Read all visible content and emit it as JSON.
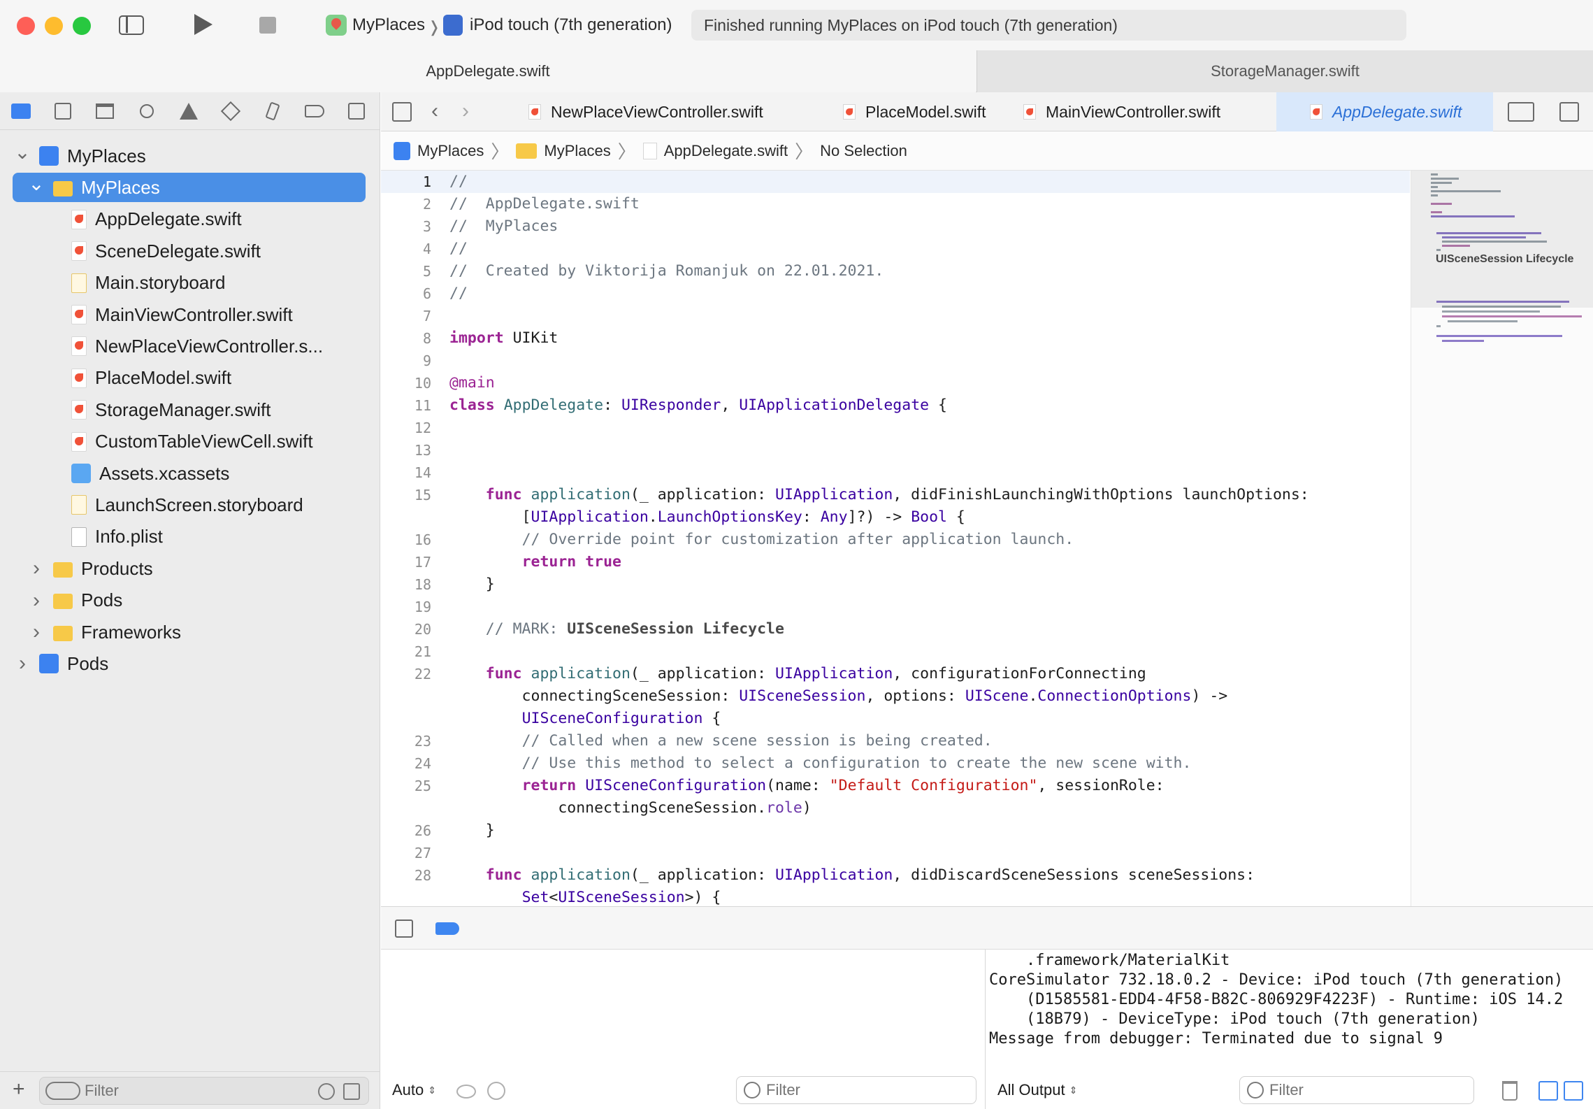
{
  "window": {
    "scheme_target": "MyPlaces",
    "scheme_device": "iPod touch (7th generation)",
    "activity_status": "Finished running MyPlaces on iPod touch (7th generation)"
  },
  "doc_tabs": {
    "left": "AppDelegate.swift",
    "right": "StorageManager.swift"
  },
  "navigator": {
    "filter_placeholder": "Filter",
    "tree": [
      {
        "label": "MyPlaces",
        "kind": "project",
        "level": 0,
        "open": true
      },
      {
        "label": "MyPlaces",
        "kind": "folder",
        "level": 1,
        "open": true,
        "selected": true
      },
      {
        "label": "AppDelegate.swift",
        "kind": "swift",
        "level": 2
      },
      {
        "label": "SceneDelegate.swift",
        "kind": "swift",
        "level": 2
      },
      {
        "label": "Main.storyboard",
        "kind": "storyboard",
        "level": 2
      },
      {
        "label": "MainViewController.swift",
        "kind": "swift",
        "level": 2
      },
      {
        "label": "NewPlaceViewController.s...",
        "kind": "swift",
        "level": 2
      },
      {
        "label": "PlaceModel.swift",
        "kind": "swift",
        "level": 2
      },
      {
        "label": "StorageManager.swift",
        "kind": "swift",
        "level": 2
      },
      {
        "label": "CustomTableViewCell.swift",
        "kind": "swift",
        "level": 2
      },
      {
        "label": "Assets.xcassets",
        "kind": "assets",
        "level": 2
      },
      {
        "label": "LaunchScreen.storyboard",
        "kind": "storyboard",
        "level": 2
      },
      {
        "label": "Info.plist",
        "kind": "plist",
        "level": 2
      },
      {
        "label": "Products",
        "kind": "folder",
        "level": 1,
        "open": false
      },
      {
        "label": "Pods",
        "kind": "folder",
        "level": 1,
        "open": false
      },
      {
        "label": "Frameworks",
        "kind": "folder",
        "level": 1,
        "open": false
      },
      {
        "label": "Pods",
        "kind": "project",
        "level": 0,
        "open": false
      }
    ]
  },
  "editor_tabs": [
    {
      "label": "NewPlaceViewController.swift",
      "active": false
    },
    {
      "label": "PlaceModel.swift",
      "active": false
    },
    {
      "label": "MainViewController.swift",
      "active": false
    },
    {
      "label": "AppDelegate.swift",
      "active": true
    }
  ],
  "jumpbar": [
    "MyPlaces",
    "MyPlaces",
    "AppDelegate.swift",
    "No Selection"
  ],
  "code": {
    "current_line": 1,
    "lines": [
      {
        "n": "1",
        "t": [
          [
            "cm",
            "//"
          ]
        ]
      },
      {
        "n": "2",
        "t": [
          [
            "cm",
            "//  AppDelegate.swift"
          ]
        ]
      },
      {
        "n": "3",
        "t": [
          [
            "cm",
            "//  MyPlaces"
          ]
        ]
      },
      {
        "n": "4",
        "t": [
          [
            "cm",
            "//"
          ]
        ]
      },
      {
        "n": "5",
        "t": [
          [
            "cm",
            "//  Created by Viktorija Romanjuk on 22.01.2021."
          ]
        ]
      },
      {
        "n": "6",
        "t": [
          [
            "cm",
            "//"
          ]
        ]
      },
      {
        "n": "7",
        "t": []
      },
      {
        "n": "8",
        "t": [
          [
            "kw",
            "import"
          ],
          [
            "",
            " UIKit"
          ]
        ]
      },
      {
        "n": "9",
        "t": []
      },
      {
        "n": "10",
        "t": [
          [
            "at",
            "@main"
          ]
        ]
      },
      {
        "n": "11",
        "t": [
          [
            "kw",
            "class"
          ],
          [
            "",
            " "
          ],
          [
            "fn",
            "AppDelegate"
          ],
          [
            "",
            ": "
          ],
          [
            "ty",
            "UIResponder"
          ],
          [
            "",
            ", "
          ],
          [
            "ty",
            "UIApplicationDelegate"
          ],
          [
            "",
            " {"
          ]
        ]
      },
      {
        "n": "12",
        "t": []
      },
      {
        "n": "13",
        "t": []
      },
      {
        "n": "14",
        "t": []
      },
      {
        "n": "15",
        "t": [
          [
            "",
            "    "
          ],
          [
            "kw",
            "func"
          ],
          [
            "",
            " "
          ],
          [
            "fn",
            "application"
          ],
          [
            "",
            "(_ application: "
          ],
          [
            "ty",
            "UIApplication"
          ],
          [
            "",
            ", didFinishLaunchingWithOptions launchOptions:"
          ]
        ]
      },
      {
        "n": "",
        "t": [
          [
            "",
            "        ["
          ],
          [
            "ty",
            "UIApplication"
          ],
          [
            "",
            "."
          ],
          [
            "ty",
            "LaunchOptionsKey"
          ],
          [
            "",
            ": "
          ],
          [
            "ty",
            "Any"
          ],
          [
            "",
            "]?) -> "
          ],
          [
            "ty",
            "Bool"
          ],
          [
            "",
            " {"
          ]
        ]
      },
      {
        "n": "16",
        "t": [
          [
            "",
            "        "
          ],
          [
            "cm",
            "// Override point for customization after application launch."
          ]
        ]
      },
      {
        "n": "17",
        "t": [
          [
            "",
            "        "
          ],
          [
            "kw",
            "return"
          ],
          [
            "",
            " "
          ],
          [
            "kw",
            "true"
          ]
        ]
      },
      {
        "n": "18",
        "t": [
          [
            "",
            "    }"
          ]
        ]
      },
      {
        "n": "19",
        "t": []
      },
      {
        "n": "20",
        "t": [
          [
            "",
            "    "
          ],
          [
            "cm",
            "// MARK: "
          ],
          [
            "mk",
            "UISceneSession Lifecycle"
          ]
        ]
      },
      {
        "n": "21",
        "t": []
      },
      {
        "n": "22",
        "t": [
          [
            "",
            "    "
          ],
          [
            "kw",
            "func"
          ],
          [
            "",
            " "
          ],
          [
            "fn",
            "application"
          ],
          [
            "",
            "(_ application: "
          ],
          [
            "ty",
            "UIApplication"
          ],
          [
            "",
            ", configurationForConnecting"
          ]
        ]
      },
      {
        "n": "",
        "t": [
          [
            "",
            "        connectingSceneSession: "
          ],
          [
            "ty",
            "UISceneSession"
          ],
          [
            "",
            ", options: "
          ],
          [
            "ty",
            "UIScene"
          ],
          [
            "",
            "."
          ],
          [
            "ty",
            "ConnectionOptions"
          ],
          [
            "",
            ") ->"
          ]
        ]
      },
      {
        "n": "",
        "t": [
          [
            "",
            "        "
          ],
          [
            "ty",
            "UISceneConfiguration"
          ],
          [
            "",
            " {"
          ]
        ]
      },
      {
        "n": "23",
        "t": [
          [
            "",
            "        "
          ],
          [
            "cm",
            "// Called when a new scene session is being created."
          ]
        ]
      },
      {
        "n": "24",
        "t": [
          [
            "",
            "        "
          ],
          [
            "cm",
            "// Use this method to select a configuration to create the new scene with."
          ]
        ]
      },
      {
        "n": "25",
        "t": [
          [
            "",
            "        "
          ],
          [
            "kw",
            "return"
          ],
          [
            "",
            " "
          ],
          [
            "ty",
            "UISceneConfiguration"
          ],
          [
            "",
            "(name: "
          ],
          [
            "st",
            "\"Default Configuration\""
          ],
          [
            "",
            ", sessionRole:"
          ]
        ]
      },
      {
        "n": "",
        "t": [
          [
            "",
            "            connectingSceneSession."
          ],
          [
            "pr",
            "role"
          ],
          [
            "",
            ")"
          ]
        ]
      },
      {
        "n": "26",
        "t": [
          [
            "",
            "    }"
          ]
        ]
      },
      {
        "n": "27",
        "t": []
      },
      {
        "n": "28",
        "t": [
          [
            "",
            "    "
          ],
          [
            "kw",
            "func"
          ],
          [
            "",
            " "
          ],
          [
            "fn",
            "application"
          ],
          [
            "",
            "(_ application: "
          ],
          [
            "ty",
            "UIApplication"
          ],
          [
            "",
            ", didDiscardSceneSessions sceneSessions:"
          ]
        ]
      },
      {
        "n": "",
        "t": [
          [
            "",
            "        "
          ],
          [
            "ty",
            "Set"
          ],
          [
            "",
            "<"
          ],
          [
            "ty",
            "UISceneSession"
          ],
          [
            "",
            ">) {"
          ]
        ]
      }
    ]
  },
  "minimap": {
    "mark_label": "UISceneSession Lifecycle"
  },
  "debug": {
    "vars_scope": "Auto",
    "vars_filter_placeholder": "Filter",
    "console_scope": "All Output",
    "console_filter_placeholder": "Filter",
    "console_lines": [
      "    .framework/MaterialKit",
      "CoreSimulator 732.18.0.2 - Device: iPod touch (7th generation)",
      "    (D1585581-EDD4-4F58-B82C-806929F4223F) - Runtime: iOS 14.2",
      "    (18B79) - DeviceType: iPod touch (7th generation)",
      "Message from debugger: Terminated due to signal 9"
    ]
  },
  "colors": {
    "selection": "#4a8fe6",
    "keyword": "#9b2393",
    "type": "#3900a0",
    "comment": "#6c7680",
    "string": "#c41a16",
    "swift_icon": "#f05138",
    "folder_icon": "#f7c948"
  }
}
